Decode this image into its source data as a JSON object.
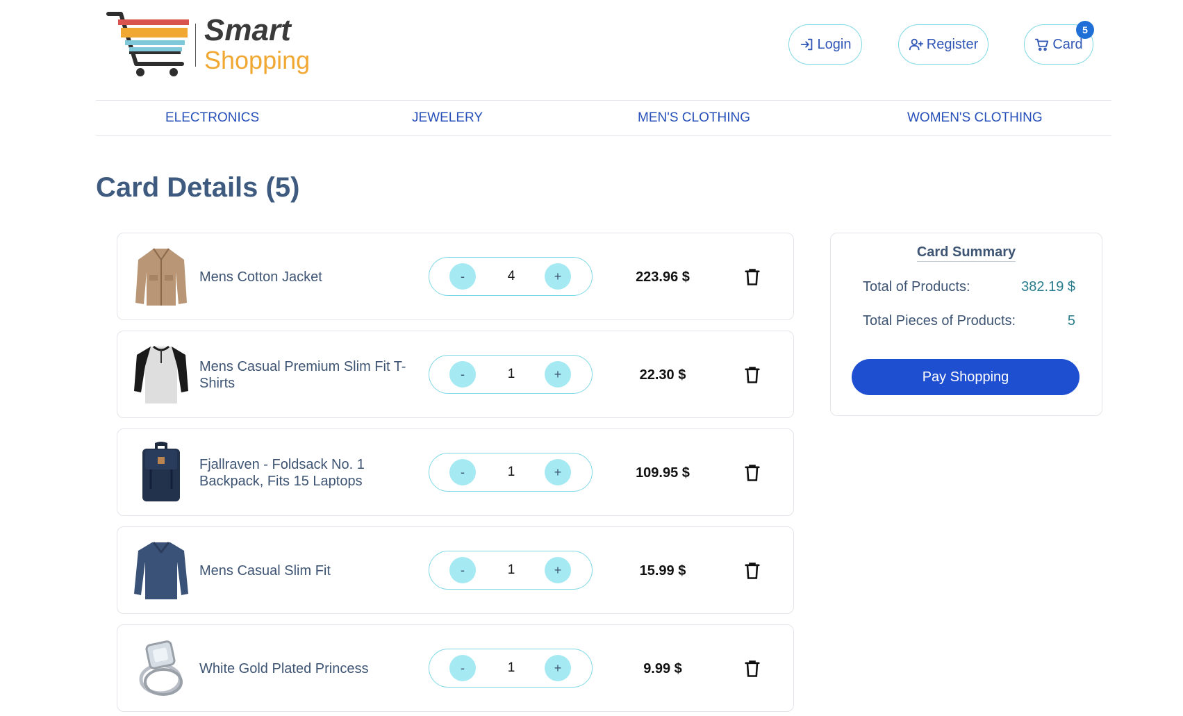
{
  "brand": {
    "name_top": "Smart",
    "name_bottom": "Shopping"
  },
  "header": {
    "login_label": "Login",
    "register_label": "Register",
    "card_label": "Card",
    "card_badge": "5"
  },
  "categories": [
    "ELECTRONICS",
    "JEWELERY",
    "MEN'S CLOTHING",
    "WOMEN'S CLOTHING"
  ],
  "page": {
    "title": "Card Details (5)"
  },
  "stepper": {
    "minus_label": "-",
    "plus_label": "+"
  },
  "cart_items": [
    {
      "name": "Mens Cotton Jacket",
      "quantity": "4",
      "price": "223.96 $",
      "thumb_icon": "jacket-icon"
    },
    {
      "name": "Mens Casual Premium Slim Fit T-Shirts",
      "quantity": "1",
      "price": "22.30 $",
      "thumb_icon": "tshirt-icon"
    },
    {
      "name": "Fjallraven - Foldsack No. 1 Backpack, Fits 15 Laptops",
      "quantity": "1",
      "price": "109.95 $",
      "thumb_icon": "backpack-icon"
    },
    {
      "name": "Mens Casual Slim Fit",
      "quantity": "1",
      "price": "15.99 $",
      "thumb_icon": "longsleeve-icon"
    },
    {
      "name": "White Gold Plated Princess",
      "quantity": "1",
      "price": "9.99 $",
      "thumb_icon": "ring-icon"
    }
  ],
  "summary": {
    "title": "Card Summary",
    "total_products_label": "Total of Products:",
    "total_products_value": "382.19 $",
    "total_pieces_label": "Total Pieces of Products:",
    "total_pieces_value": "5",
    "pay_label": "Pay Shopping"
  },
  "colors": {
    "accent": "#1f4fd1",
    "link": "#2750b8",
    "stepper_button": "#a5e9f2",
    "outline": "#7fd8e6",
    "badge": "#1f6fd6",
    "logo_orange": "#f0a832"
  }
}
